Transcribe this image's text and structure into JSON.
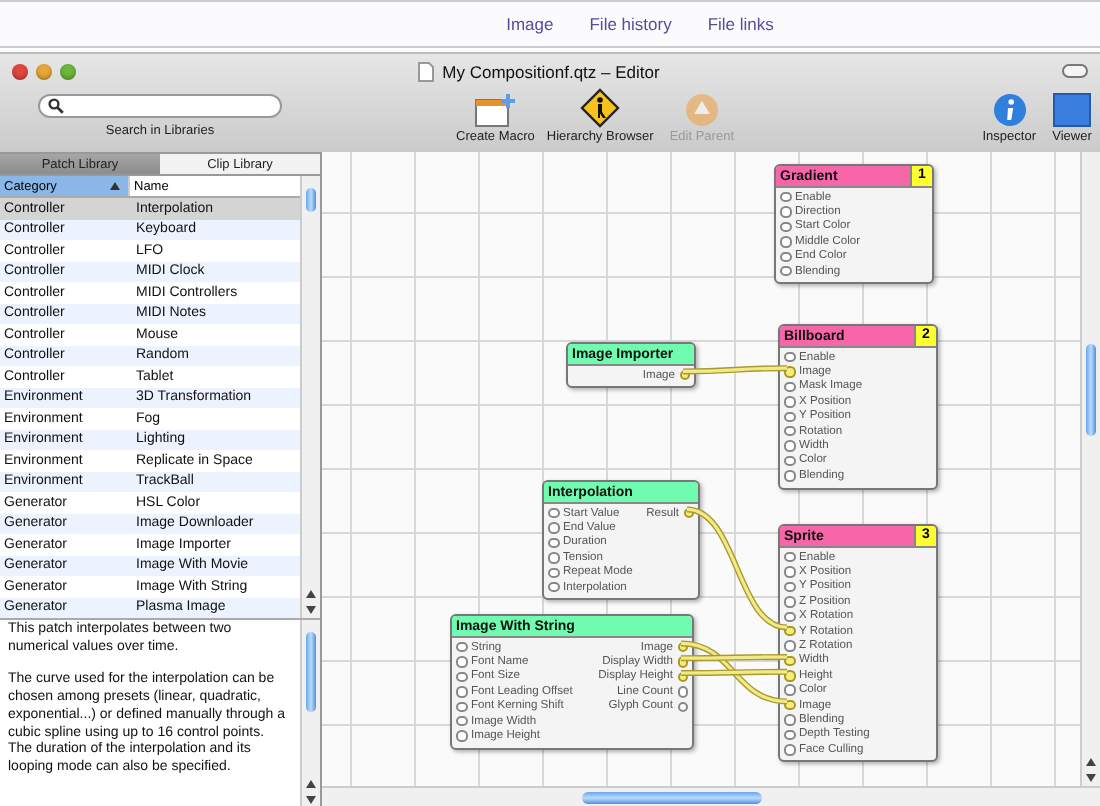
{
  "top_links": [
    {
      "label": "Image"
    },
    {
      "label": "File history"
    },
    {
      "label": "File links"
    }
  ],
  "window": {
    "title": "My Compositionf.qtz – Editor"
  },
  "toolbar": {
    "search": {
      "label": "Search in Libraries"
    },
    "buttons": [
      {
        "label": "Create Macro",
        "kind": "macro",
        "disabled": false
      },
      {
        "label": "Hierarchy Browser",
        "kind": "hierarchy",
        "disabled": false
      },
      {
        "label": "Edit Parent",
        "kind": "parent",
        "disabled": true
      },
      {
        "label": "Inspector",
        "kind": "inspector",
        "disabled": false
      },
      {
        "label": "Viewer",
        "kind": "viewer",
        "disabled": false
      }
    ]
  },
  "library_tabs": [
    {
      "label": "Patch Library",
      "selected": true
    },
    {
      "label": "Clip Library",
      "selected": false
    }
  ],
  "table": {
    "columns": [
      "Category",
      "Name"
    ],
    "rows": [
      {
        "category": "Controller",
        "name": "Interpolation",
        "selected": true
      },
      {
        "category": "Controller",
        "name": "Keyboard",
        "selected": false
      },
      {
        "category": "Controller",
        "name": "LFO",
        "selected": false
      },
      {
        "category": "Controller",
        "name": "MIDI Clock",
        "selected": false
      },
      {
        "category": "Controller",
        "name": "MIDI Controllers",
        "selected": false
      },
      {
        "category": "Controller",
        "name": "MIDI Notes",
        "selected": false
      },
      {
        "category": "Controller",
        "name": "Mouse",
        "selected": false
      },
      {
        "category": "Controller",
        "name": "Random",
        "selected": false
      },
      {
        "category": "Controller",
        "name": "Tablet",
        "selected": false
      },
      {
        "category": "Environment",
        "name": "3D Transformation",
        "selected": false
      },
      {
        "category": "Environment",
        "name": "Fog",
        "selected": false
      },
      {
        "category": "Environment",
        "name": "Lighting",
        "selected": false
      },
      {
        "category": "Environment",
        "name": "Replicate in Space",
        "selected": false
      },
      {
        "category": "Environment",
        "name": "TrackBall",
        "selected": false
      },
      {
        "category": "Generator",
        "name": "HSL Color",
        "selected": false
      },
      {
        "category": "Generator",
        "name": "Image Downloader",
        "selected": false
      },
      {
        "category": "Generator",
        "name": "Image Importer",
        "selected": false
      },
      {
        "category": "Generator",
        "name": "Image With Movie",
        "selected": false
      },
      {
        "category": "Generator",
        "name": "Image With String",
        "selected": false
      },
      {
        "category": "Generator",
        "name": "Plasma Image",
        "selected": false
      }
    ]
  },
  "description": [
    "This patch interpolates between two numerical values over time.",
    "The curve used for the interpolation can be chosen among presets (linear, quadratic, exponential...) or defined manually through a cubic spline using up to 16 control points.\nThe duration of the interpolation and its looping mode can also be specified."
  ],
  "nodes": [
    {
      "title": "Gradient",
      "color": "#f766a8",
      "layer": "1",
      "inputs": [
        {
          "name": "Enable",
          "connected": false
        },
        {
          "name": "Direction",
          "connected": false
        },
        {
          "name": "Start Color",
          "connected": false
        },
        {
          "name": "Middle Color",
          "connected": false
        },
        {
          "name": "End Color",
          "connected": false
        },
        {
          "name": "Blending",
          "connected": false
        }
      ]
    },
    {
      "title": "Image Importer",
      "color": "#6ffcb0",
      "outputs": [
        {
          "name": "Image",
          "connected": true
        }
      ]
    },
    {
      "title": "Billboard",
      "color": "#f766a8",
      "layer": "2",
      "inputs": [
        {
          "name": "Enable",
          "connected": false
        },
        {
          "name": "Image",
          "connected": true
        },
        {
          "name": "Mask Image",
          "connected": false
        },
        {
          "name": "X Position",
          "connected": false
        },
        {
          "name": "Y Position",
          "connected": false
        },
        {
          "name": "Rotation",
          "connected": false
        },
        {
          "name": "Width",
          "connected": false
        },
        {
          "name": "Color",
          "connected": false
        },
        {
          "name": "Blending",
          "connected": false
        }
      ]
    },
    {
      "title": "Interpolation",
      "color": "#6ffcb0",
      "inputs": [
        {
          "name": "Start Value",
          "connected": false
        },
        {
          "name": "End Value",
          "connected": false
        },
        {
          "name": "Duration",
          "connected": false
        },
        {
          "name": "Tension",
          "connected": false
        },
        {
          "name": "Repeat Mode",
          "connected": false
        },
        {
          "name": "Interpolation",
          "connected": false
        }
      ],
      "outputs": [
        {
          "name": "Result",
          "connected": true
        }
      ]
    },
    {
      "title": "Sprite",
      "color": "#f766a8",
      "layer": "3",
      "inputs": [
        {
          "name": "Enable",
          "connected": false
        },
        {
          "name": "X Position",
          "connected": false
        },
        {
          "name": "Y Position",
          "connected": false
        },
        {
          "name": "Z Position",
          "connected": false
        },
        {
          "name": "X Rotation",
          "connected": false
        },
        {
          "name": "Y Rotation",
          "connected": true
        },
        {
          "name": "Z Rotation",
          "connected": false
        },
        {
          "name": "Width",
          "connected": true
        },
        {
          "name": "Height",
          "connected": true
        },
        {
          "name": "Color",
          "connected": false
        },
        {
          "name": "Image",
          "connected": true
        },
        {
          "name": "Blending",
          "connected": false
        },
        {
          "name": "Depth Testing",
          "connected": false
        },
        {
          "name": "Face Culling",
          "connected": false
        }
      ]
    },
    {
      "title": "Image With String",
      "color": "#6ffcb0",
      "inputs": [
        {
          "name": "String",
          "connected": false
        },
        {
          "name": "Font Name",
          "connected": false
        },
        {
          "name": "Font Size",
          "connected": false
        },
        {
          "name": "Font Leading Offset",
          "connected": false
        },
        {
          "name": "Font Kerning Shift",
          "connected": false
        },
        {
          "name": "Image Width",
          "connected": false
        },
        {
          "name": "Image Height",
          "connected": false
        }
      ],
      "outputs": [
        {
          "name": "Image",
          "connected": true
        },
        {
          "name": "Display Width",
          "connected": true
        },
        {
          "name": "Display Height",
          "connected": true
        },
        {
          "name": "Line Count",
          "connected": false
        },
        {
          "name": "Glyph Count",
          "connected": false
        }
      ]
    }
  ]
}
